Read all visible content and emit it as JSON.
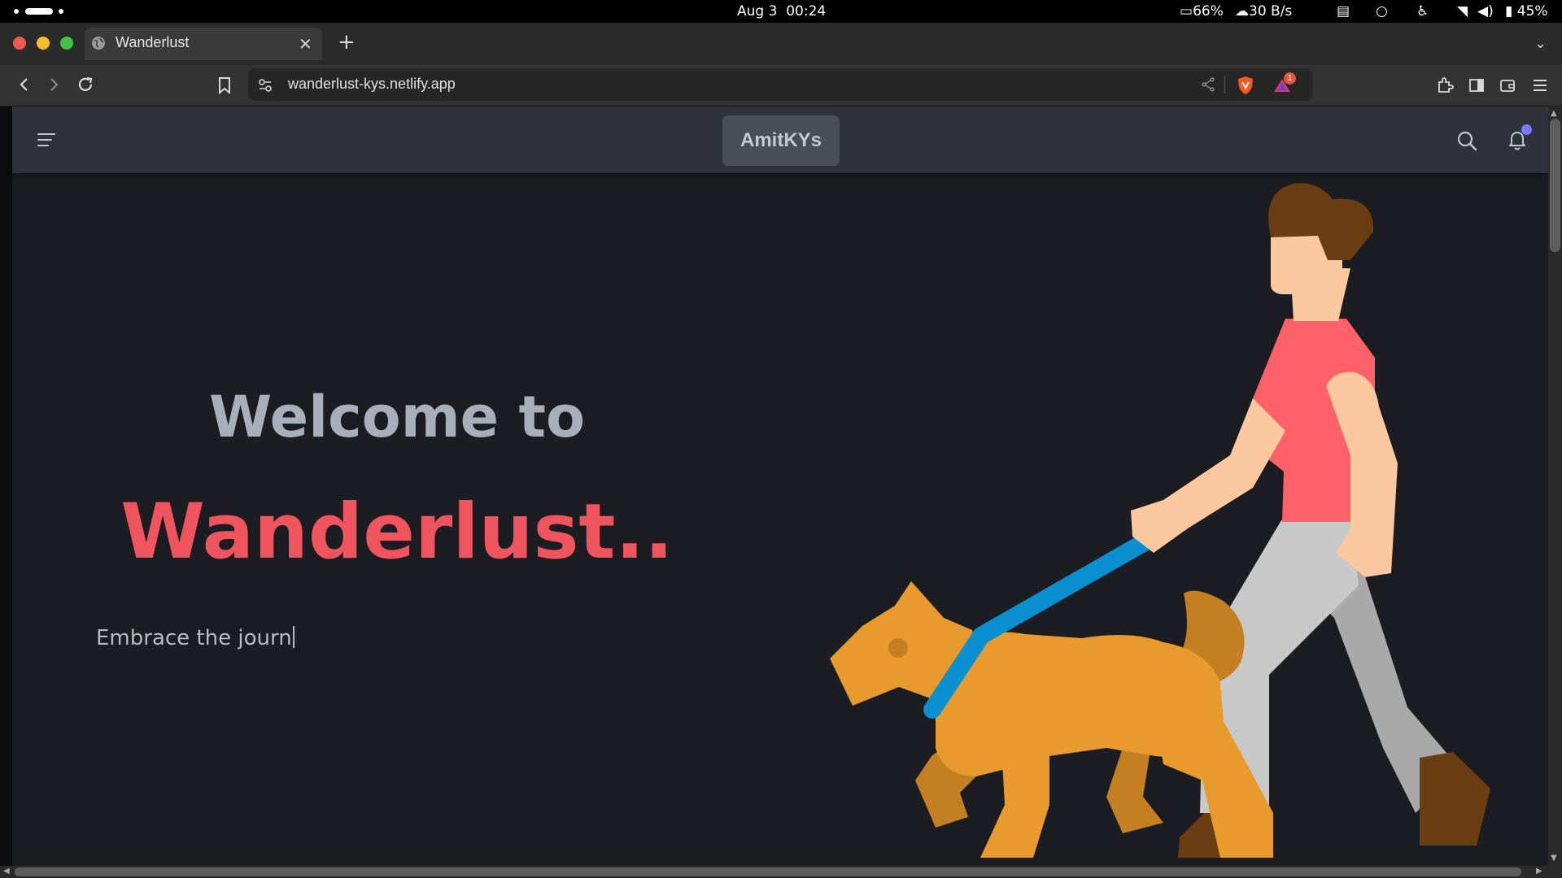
{
  "system_bar": {
    "date": "Aug 3",
    "time": "00:24",
    "cpu": "66%",
    "network": "30 B/s",
    "battery": "45%"
  },
  "browser": {
    "tab_title": "Wanderlust",
    "new_tab_label": "+",
    "url": "wanderlust-kys.netlify.app",
    "notification_badge": "1"
  },
  "site": {
    "brand": "AmitKYs",
    "welcome": "Welcome to",
    "name": "Wanderlust..",
    "tagline": "Embrace the journ"
  },
  "colors": {
    "accent": "#f0545f",
    "nav_bg": "#2f323a",
    "page_bg": "#1b1d22",
    "leash": "#0a8fd0",
    "dog": "#e99a2c",
    "shirt": "#ff6168",
    "notification_dot": "#7b7bff"
  },
  "icons": [
    "menu-icon",
    "search-icon",
    "bell-icon",
    "back-icon",
    "forward-icon",
    "reload-icon",
    "bookmark-icon",
    "share-icon",
    "brave-shield-icon",
    "extensions-icon",
    "sidebar-icon",
    "wallet-icon",
    "hamburger-menu-icon"
  ]
}
